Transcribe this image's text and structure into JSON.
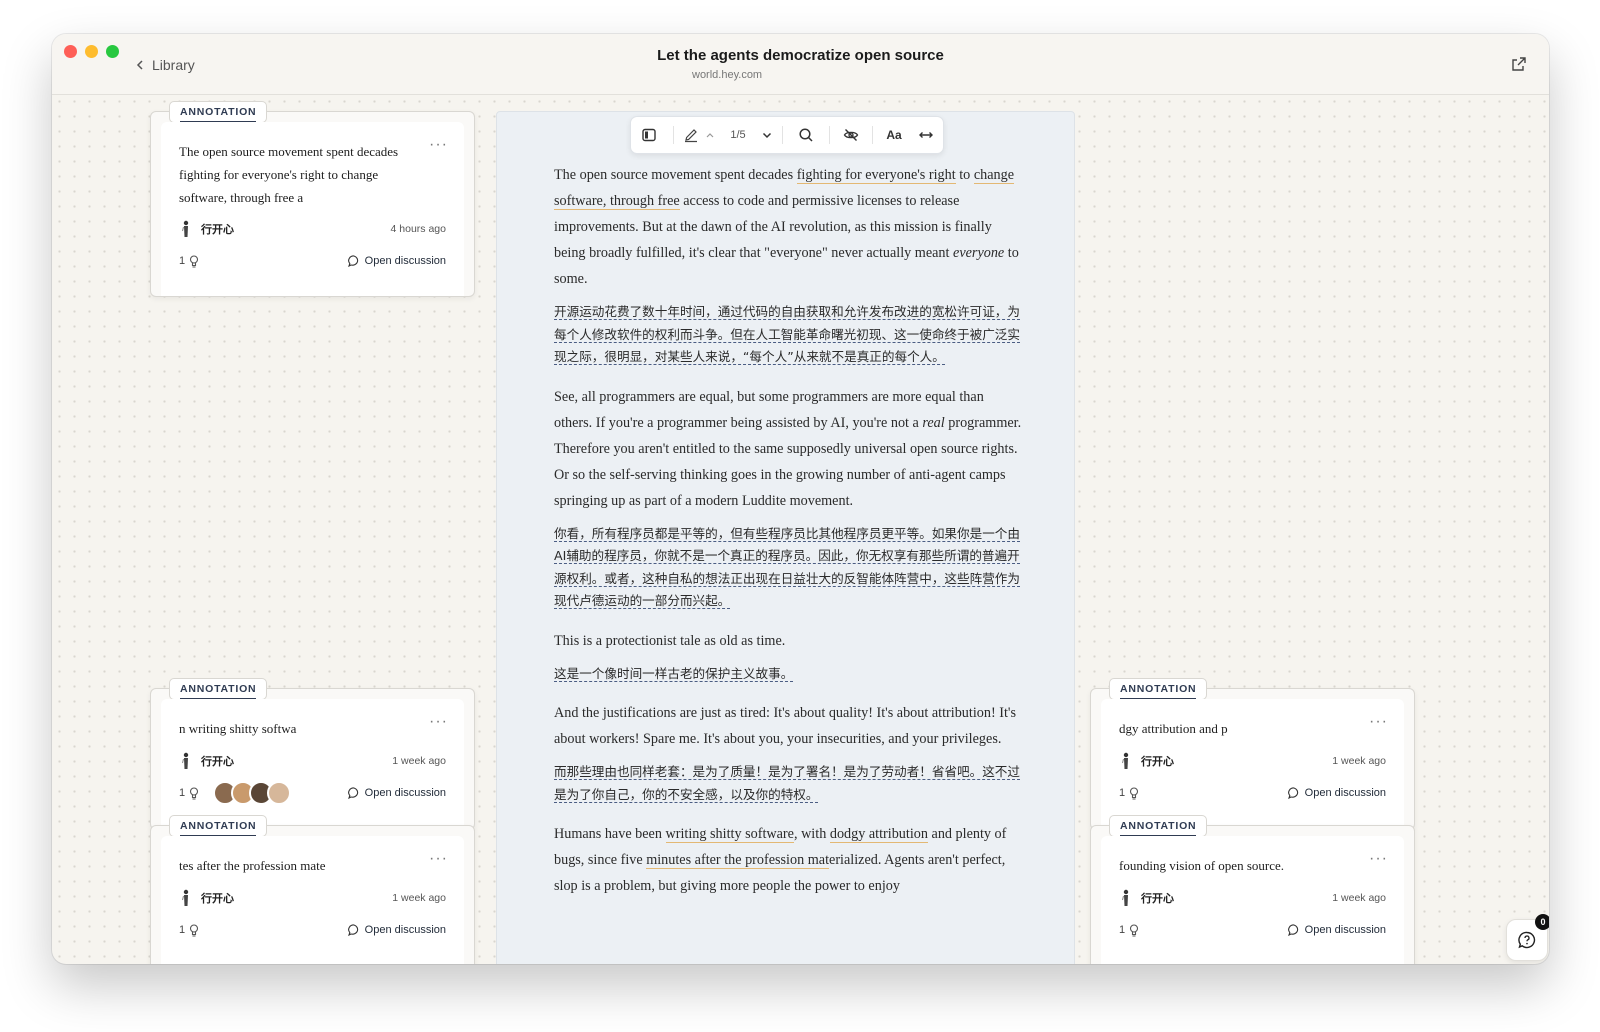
{
  "window": {
    "title": "Let the agents democratize open source",
    "url": "world.hey.com",
    "back_label": "Library"
  },
  "toolbar": {
    "page_indicator": "1/5",
    "font_label": "Aa"
  },
  "annotation_tab_label": "ANNOTATION",
  "open_discussion_label": "Open discussion",
  "left_annotations": [
    {
      "quote": "The open source movement spent decades fighting for everyone's right to change software, through free a",
      "user": "行开心",
      "time": "4 hours ago",
      "count": "1"
    },
    {
      "quote": "n writing shitty softwa",
      "user": "行开心",
      "time": "1 week ago",
      "count": "1"
    },
    {
      "quote": "tes after the profession mate",
      "user": "行开心",
      "time": "1 week ago",
      "count": "1"
    }
  ],
  "right_annotations": [
    {
      "quote": "dgy attribution and p",
      "user": "行开心",
      "time": "1 week ago",
      "count": "1"
    },
    {
      "quote": "founding vision of open source.",
      "user": "行开心",
      "time": "1 week ago",
      "count": "1"
    }
  ],
  "article": {
    "p1": {
      "a": "The open source movement spent decades ",
      "b": "fighting for everyone's right",
      "c": " to ",
      "d": "change software, through free",
      "e": " access to code and permissive licenses to release improvements. But at the dawn of the AI revolution, as this mission is finally being broadly fulfilled, it's clear that \"everyone\" never actually meant ",
      "f": "everyone",
      "g": " to some."
    },
    "zh1": "开源运动花费了数十年时间，通过代码的自由获取和允许发布改进的宽松许可证，为每个人修改软件的权利而斗争。但在人工智能革命曙光初现、这一使命终于被广泛实现之际，很明显，对某些人来说，“每个人”从来就不是真正的每个人。",
    "p2": {
      "a": "See, all programmers are equal, but some programmers are more equal than others. If you're a programmer being assisted by AI, you're not a ",
      "b": "real",
      "c": " programmer. Therefore you aren't entitled to the same supposedly universal open source rights. Or so the self-serving thinking goes in the growing number of anti-agent camps springing up as part of a modern Luddite movement."
    },
    "zh2": "你看，所有程序员都是平等的，但有些程序员比其他程序员更平等。如果你是一个由AI辅助的程序员，你就不是一个真正的程序员。因此，你无权享有那些所谓的普遍开源权利。或者，这种自私的想法正出现在日益壮大的反智能体阵营中，这些阵营作为现代卢德运动的一部分而兴起。",
    "p3": "This is a protectionist tale as old as time.",
    "zh3": "这是一个像时间一样古老的保护主义故事。",
    "p4": "And the justifications are just as tired: It's about quality! It's about attribution! It's about workers! Spare me. It's about you, your insecurities, and your privileges.",
    "zh4": "而那些理由也同样老套：是为了质量！是为了署名！是为了劳动者！省省吧。这不过是为了你自己，你的不安全感，以及你的特权。",
    "p5": {
      "a": "Humans have been ",
      "b": "writing shitty software",
      "c": ", with ",
      "d": "dodgy attribution",
      "e": " and plenty of bugs, since five ",
      "f": "minutes after the profession mat",
      "g": "erialized. Agents aren't perfect, slop is a problem, but giving more people the power to enjoy"
    }
  },
  "help_badge": "0",
  "icons": [
    "chevron-left-icon",
    "external-link-icon",
    "sidebar-toggle-icon",
    "pen-icon",
    "chevron-up-icon",
    "chevron-down-icon",
    "search-icon",
    "eye-off-icon",
    "expand-width-icon",
    "more-icon",
    "comment-icon",
    "lightbulb-icon",
    "help-icon"
  ]
}
